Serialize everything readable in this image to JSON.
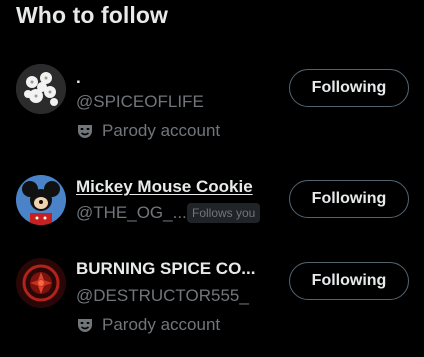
{
  "section": {
    "title": "Who to follow"
  },
  "accounts": [
    {
      "name": ".",
      "handle": "@SPICEOFLIFE",
      "label": "Parody account",
      "button": "Following",
      "avatar_icon": "white-flowers-avatar"
    },
    {
      "name": "Mickey Mouse Cookie",
      "handle": "@THE_OG_...",
      "badge": "Follows you",
      "button": "Following",
      "avatar_icon": "mickey-mouse-avatar"
    },
    {
      "name": "BURNING SPICE CO...",
      "handle": "@DESTRUCTOR555_",
      "label": "Parody account",
      "button": "Following",
      "avatar_icon": "red-emblem-avatar"
    }
  ],
  "colors": {
    "background": "#000000",
    "primary_text": "#e7e9ea",
    "secondary_text": "#71767b",
    "button_border": "#536471",
    "badge_bg": "#202327"
  }
}
